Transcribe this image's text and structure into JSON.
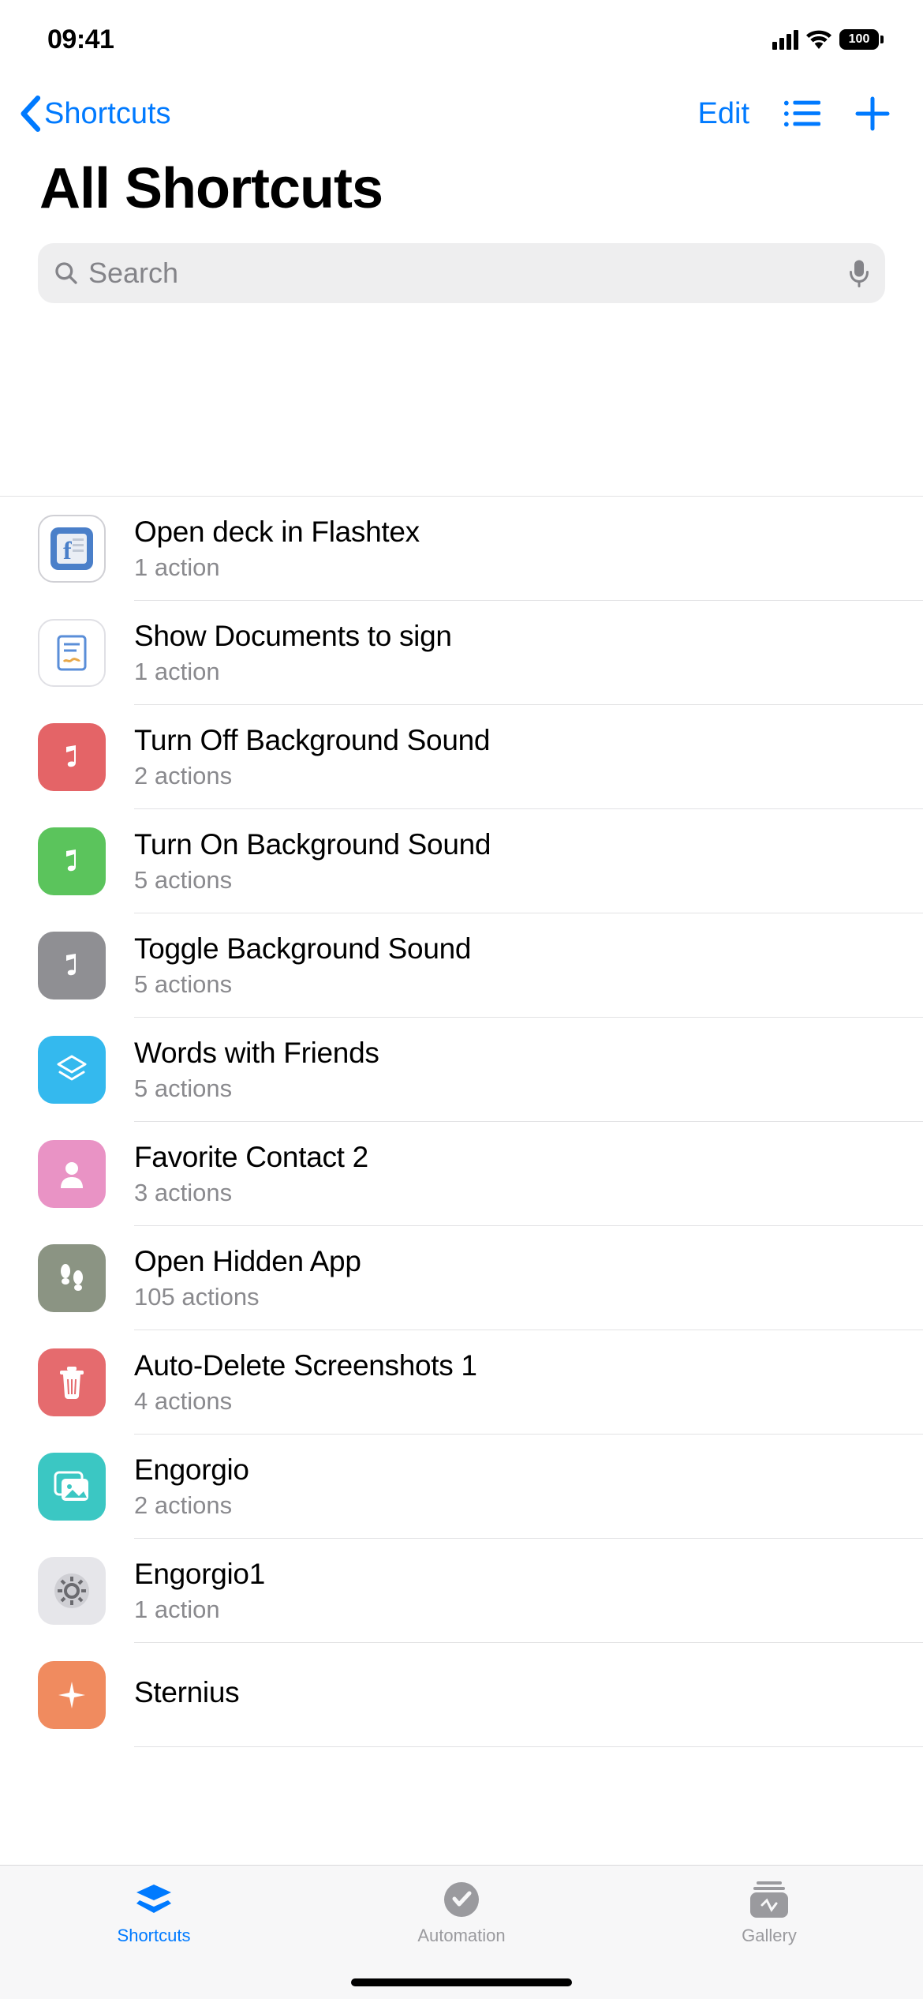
{
  "status": {
    "time": "09:41",
    "battery": "100"
  },
  "nav": {
    "back": "Shortcuts",
    "edit": "Edit"
  },
  "title": "All Shortcuts",
  "search": {
    "placeholder": "Search"
  },
  "shortcuts": [
    {
      "title": "Open deck in Flashtex",
      "sub": "1 action",
      "icon": "flashtex",
      "cls": "ic-flashtex"
    },
    {
      "title": "Show Documents to sign",
      "sub": "1 action",
      "icon": "document-sign",
      "cls": "ic-docs"
    },
    {
      "title": "Turn Off Background Sound",
      "sub": "2 actions",
      "icon": "music-note",
      "cls": "ic-red"
    },
    {
      "title": "Turn On Background Sound",
      "sub": "5 actions",
      "icon": "music-note",
      "cls": "ic-green"
    },
    {
      "title": "Toggle Background Sound",
      "sub": "5 actions",
      "icon": "music-note",
      "cls": "ic-gray"
    },
    {
      "title": "Words with Friends",
      "sub": "5 actions",
      "icon": "layers",
      "cls": "ic-blue"
    },
    {
      "title": "Favorite Contact 2",
      "sub": "3 actions",
      "icon": "person",
      "cls": "ic-pink"
    },
    {
      "title": "Open Hidden App",
      "sub": "105 actions",
      "icon": "footsteps",
      "cls": "ic-olive"
    },
    {
      "title": "Auto-Delete Screenshots 1",
      "sub": "4 actions",
      "icon": "trash",
      "cls": "ic-coral"
    },
    {
      "title": "Engorgio",
      "sub": "2 actions",
      "icon": "images",
      "cls": "ic-teal"
    },
    {
      "title": "Engorgio1",
      "sub": "1 action",
      "icon": "gear",
      "cls": "ic-gear"
    },
    {
      "title": "Sternius",
      "sub": "",
      "icon": "sparkle",
      "cls": "ic-orange"
    }
  ],
  "tabs": {
    "shortcuts": "Shortcuts",
    "automation": "Automation",
    "gallery": "Gallery"
  }
}
